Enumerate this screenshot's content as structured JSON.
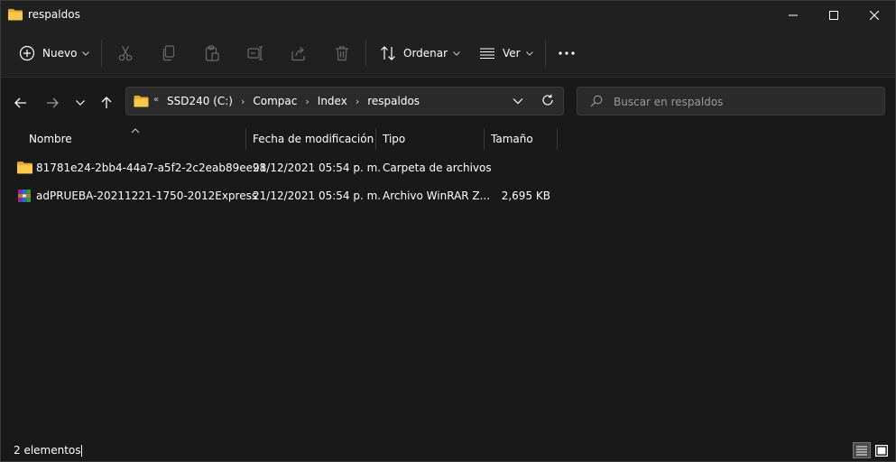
{
  "window": {
    "title": "respaldos"
  },
  "toolbar": {
    "new_label": "Nuevo",
    "sort_label": "Ordenar",
    "view_label": "Ver"
  },
  "address": {
    "prefix": "«",
    "crumbs": [
      "SSD240 (C:)",
      "Compac",
      "Index",
      "respaldos"
    ]
  },
  "search": {
    "placeholder": "Buscar en respaldos",
    "value": ""
  },
  "columns": {
    "name": "Nombre",
    "modified": "Fecha de modificación",
    "type": "Tipo",
    "size": "Tamaño"
  },
  "files": [
    {
      "name": "81781e24-2bb4-44a7-a5f2-2c2eab89ee98",
      "modified": "21/12/2021 05:54 p. m.",
      "type": "Carpeta de archivos",
      "size": "",
      "icon": "folder-icon"
    },
    {
      "name": "adPRUEBA-20211221-1750-2012Express",
      "modified": "21/12/2021 05:54 p. m.",
      "type": "Archivo WinRAR Z...",
      "size": "2,695 KB",
      "icon": "winrar-archive-icon"
    }
  ],
  "status": {
    "count": "2 elementos"
  },
  "colors": {
    "background": "#191919",
    "chrome": "#202020",
    "folder": "#f5c242",
    "text": "#ffffff",
    "muted": "#9a9a9a"
  }
}
